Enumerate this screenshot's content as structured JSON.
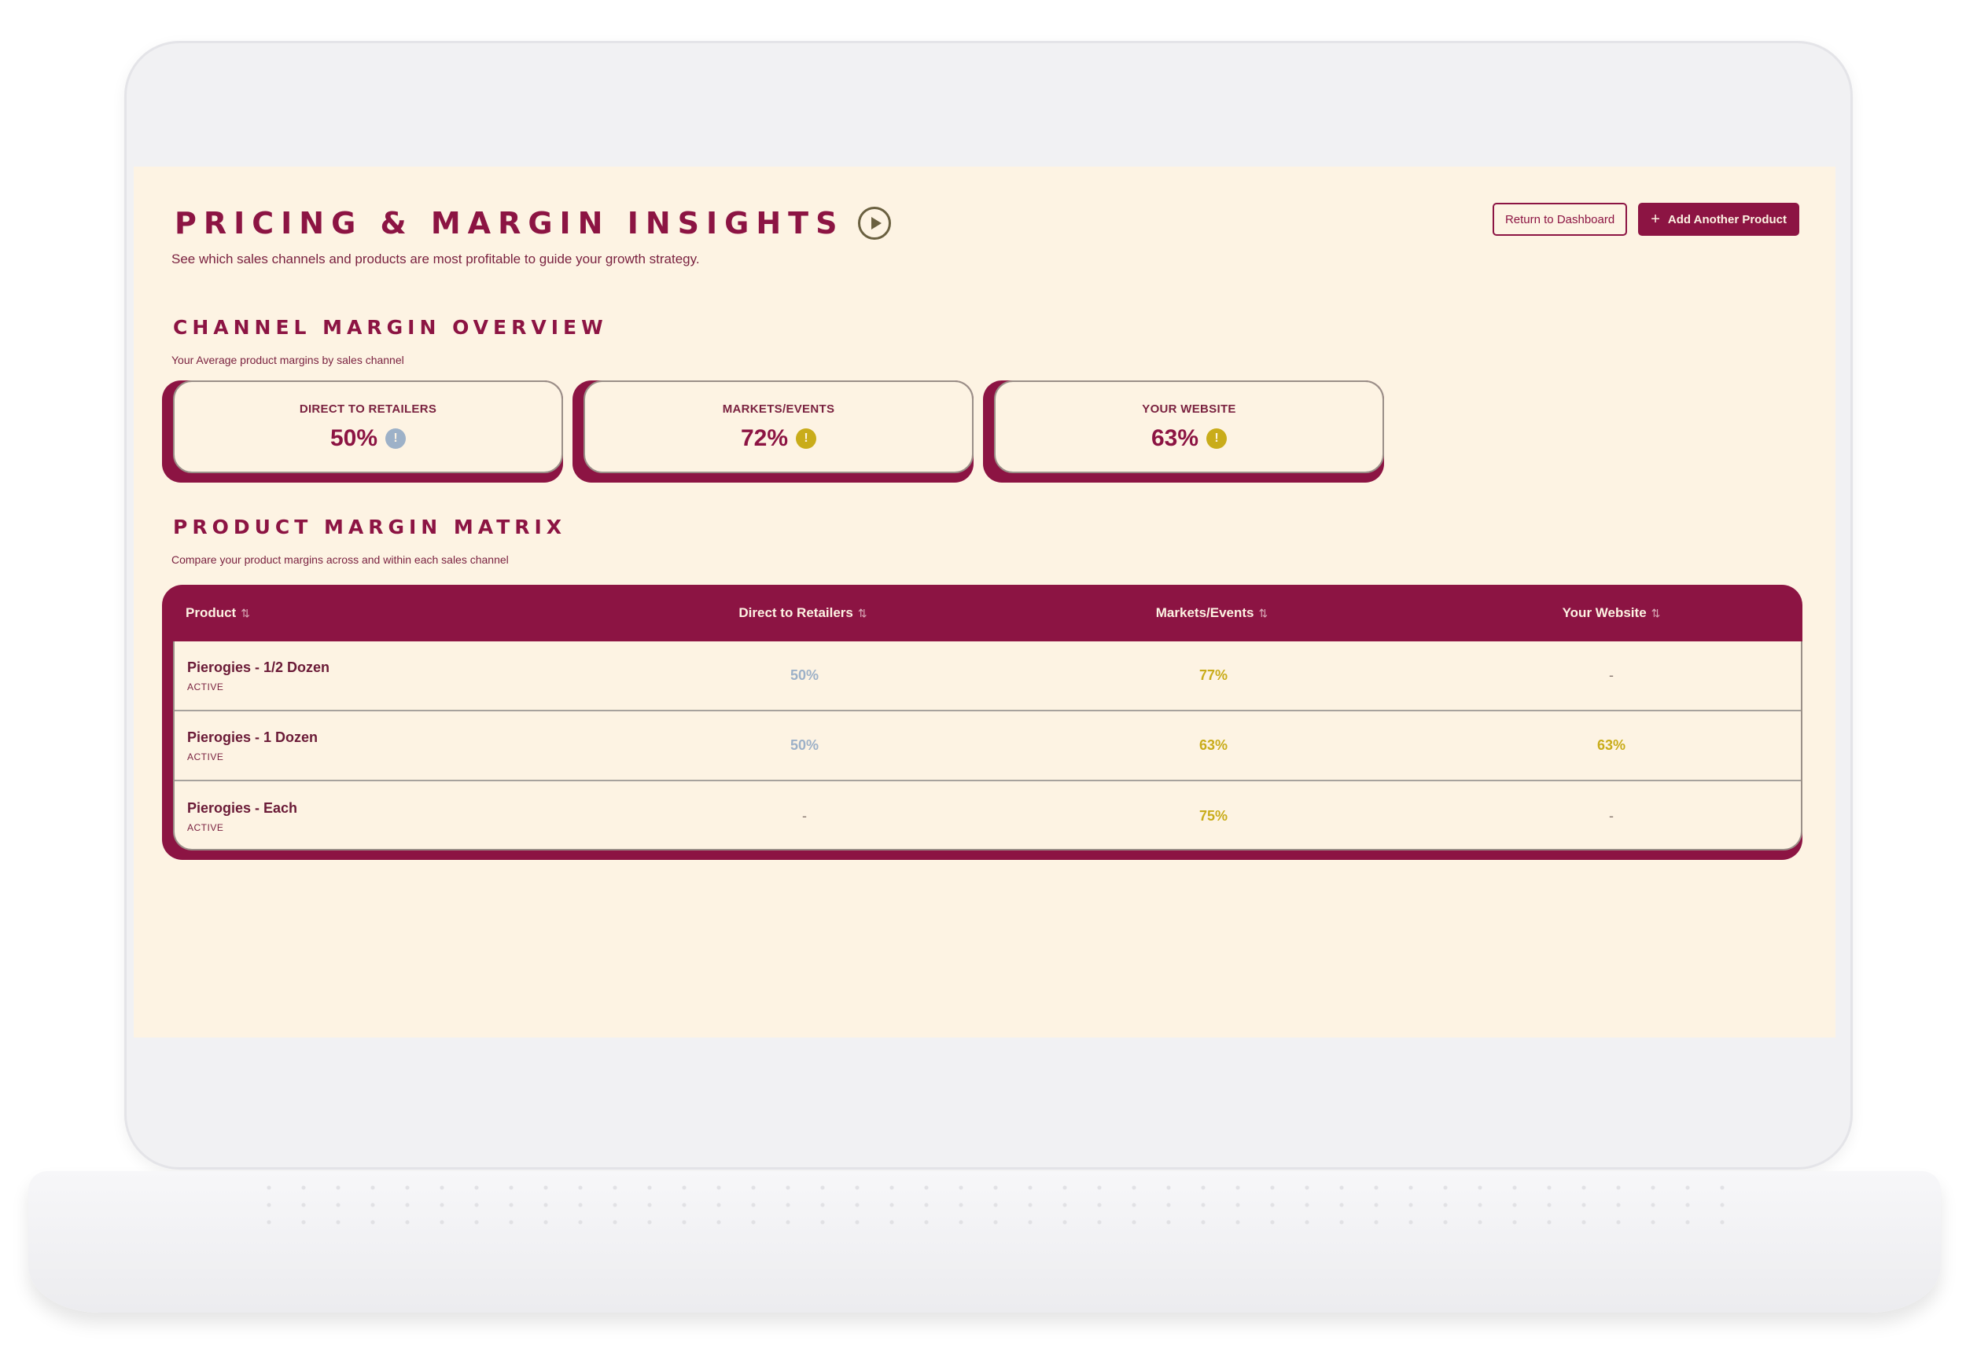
{
  "header": {
    "title": "PRICING & MARGIN INSIGHTS",
    "subtitle": "See which sales channels and products are most profitable to guide your growth strategy.",
    "return_button": "Return to Dashboard",
    "add_button": "Add Another Product",
    "add_icon": "+"
  },
  "channel_overview": {
    "title": "CHANNEL MARGIN OVERVIEW",
    "subtitle": "Your Average product margins by sales channel",
    "cards": [
      {
        "label": "DIRECT TO RETAILERS",
        "value": "50%",
        "status_icon": "!",
        "status_color": "#9db1c8"
      },
      {
        "label": "MARKETS/EVENTS",
        "value": "72%",
        "status_icon": "!",
        "status_color": "#c9ac1a"
      },
      {
        "label": "YOUR WEBSITE",
        "value": "63%",
        "status_icon": "!",
        "status_color": "#c9ac1a"
      }
    ]
  },
  "matrix": {
    "title": "PRODUCT MARGIN MATRIX",
    "subtitle": "Compare your product margins across and within each sales channel",
    "sort_icon": "⇅",
    "columns": [
      "Product",
      "Direct to Retailers",
      "Markets/Events",
      "Your Website"
    ],
    "rows": [
      {
        "product": "Pierogies - 1/2 Dozen",
        "status": "ACTIVE",
        "direct": "50%",
        "markets": "77%",
        "website": "-"
      },
      {
        "product": "Pierogies - 1 Dozen",
        "status": "ACTIVE",
        "direct": "50%",
        "markets": "63%",
        "website": "63%"
      },
      {
        "product": "Pierogies - Each",
        "status": "ACTIVE",
        "direct": "-",
        "markets": "75%",
        "website": "-"
      }
    ]
  },
  "colors": {
    "brand": "#8c1443",
    "background": "#fdf3e3",
    "low_margin": "#9db1c8",
    "good_margin": "#c9ac1a"
  }
}
